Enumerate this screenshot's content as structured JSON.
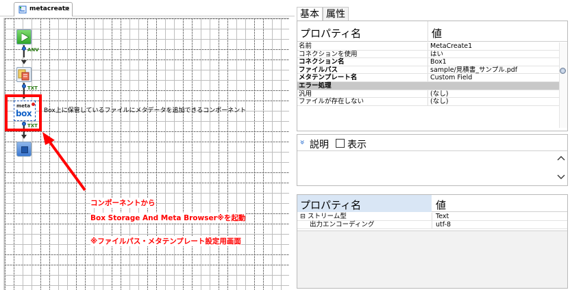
{
  "editor": {
    "tab_label": "metacreate",
    "tab_close": "×",
    "ports": {
      "anv": "ANV",
      "txt1": "TXT",
      "txt2": "TXT"
    },
    "meta_icon": {
      "word1": "meta",
      "word2": "box"
    },
    "component_description": "Box上に保管しているファイルにメタデータを追加できるコンポーネント",
    "annotation": {
      "line1": "コンポーネントから",
      "line2": "Box  Storage And Meta Browser※を起動",
      "line3": "※ファイルパス・メタテンプレート設定用画面",
      "color": "#ff0000"
    }
  },
  "right_tabs": {
    "basic": "基本",
    "attributes": "属性"
  },
  "properties": {
    "header_name": "プロパティ名",
    "header_value": "値",
    "rows": [
      {
        "key": "名前",
        "value": "MetaCreate1",
        "bold": false
      },
      {
        "key": "コネクションを使用",
        "value": "はい",
        "bold": false
      },
      {
        "key": "コネクション名",
        "value": "Box1",
        "bold": true
      },
      {
        "key": "ファイルパス",
        "value": "sample/見積書_サンプル.pdf",
        "bold": true
      },
      {
        "key": "メタテンプレート名",
        "value": "Custom Field",
        "bold": true
      },
      {
        "key": "エラー処理",
        "value": "",
        "section": true
      },
      {
        "key": "汎用",
        "value": "(なし)",
        "bold": false
      },
      {
        "key": "ファイルが存在しない",
        "value": "(なし)",
        "bold": false
      }
    ]
  },
  "description_panel": {
    "label": "説明",
    "show_label": "表示",
    "chevron": "»"
  },
  "stream_properties": {
    "header_name": "プロパティ名",
    "header_value": "値",
    "rows": [
      {
        "key": "⊟ ストリーム型",
        "value": "Text",
        "indent": false
      },
      {
        "key": "出力エンコーディング",
        "value": "utf-8",
        "indent": true
      }
    ]
  },
  "colors": {
    "accent_blue": "#2a6fd0",
    "highlight_red": "#ff0000",
    "selected_header": "#d9e6f5"
  }
}
